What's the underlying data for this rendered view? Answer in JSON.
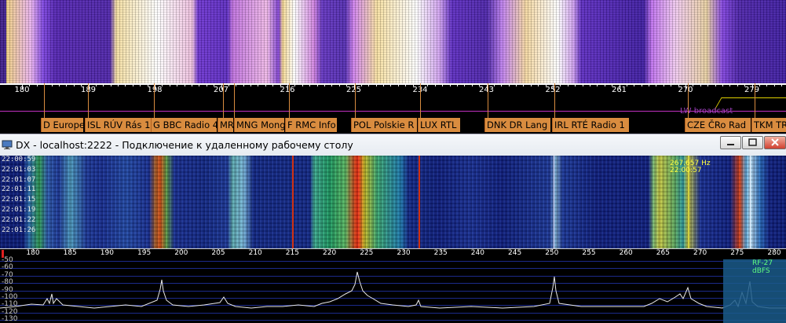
{
  "top_scale": {
    "ticks": [
      "180",
      "189",
      "198",
      "207",
      "216",
      "225",
      "234",
      "243",
      "252",
      "261",
      "270",
      "279"
    ],
    "band_label": "LW broadcast"
  },
  "stations": [
    {
      "label": "D Europe"
    },
    {
      "label": "ISL RÚV Rás 1"
    },
    {
      "label": "G BBC Radio 4"
    },
    {
      "label": "MR"
    },
    {
      "label": "MNG Mong"
    },
    {
      "label": "F RMC Info"
    },
    {
      "label": "POL Polskie R"
    },
    {
      "label": "LUX RTL"
    },
    {
      "label": "DNK DR Lang"
    },
    {
      "label": "IRL RTÉ Radio 1"
    },
    {
      "label": "CZE ČRo Rad"
    },
    {
      "label": "TKM TR"
    }
  ],
  "window": {
    "title": "DX - localhost:2222 - Подключение к удаленному рабочему столу",
    "minimize_icon": "minimize-icon",
    "restore_icon": "restore-icon",
    "close_icon": "close-icon"
  },
  "waterfall": {
    "timestamps": [
      "22:00:59",
      "22:01:03",
      "22:01:07",
      "22:01:11",
      "22:01:15",
      "22:01:19",
      "22:01:22",
      "22:01:26"
    ],
    "popup": {
      "freq": "267.657 Hz",
      "time": "22:00:57"
    }
  },
  "bottom_scale": {
    "ticks": [
      "180",
      "185",
      "190",
      "195",
      "200",
      "205",
      "210",
      "215",
      "220",
      "225",
      "230",
      "235",
      "240",
      "245",
      "250",
      "255",
      "260",
      "265",
      "270",
      "275",
      "280"
    ]
  },
  "spectrum": {
    "db_labels": [
      "-50",
      "-60",
      "-70",
      "-80",
      "-90",
      "-100",
      "-110",
      "-120",
      "-130"
    ],
    "rf_label": "RF-27 dBFS"
  },
  "colors": {
    "station_tag": "#d98c3f",
    "lw_line": "#e0d000",
    "band_marker": "#c030c0",
    "timestamp_popup": "#ffff40"
  }
}
